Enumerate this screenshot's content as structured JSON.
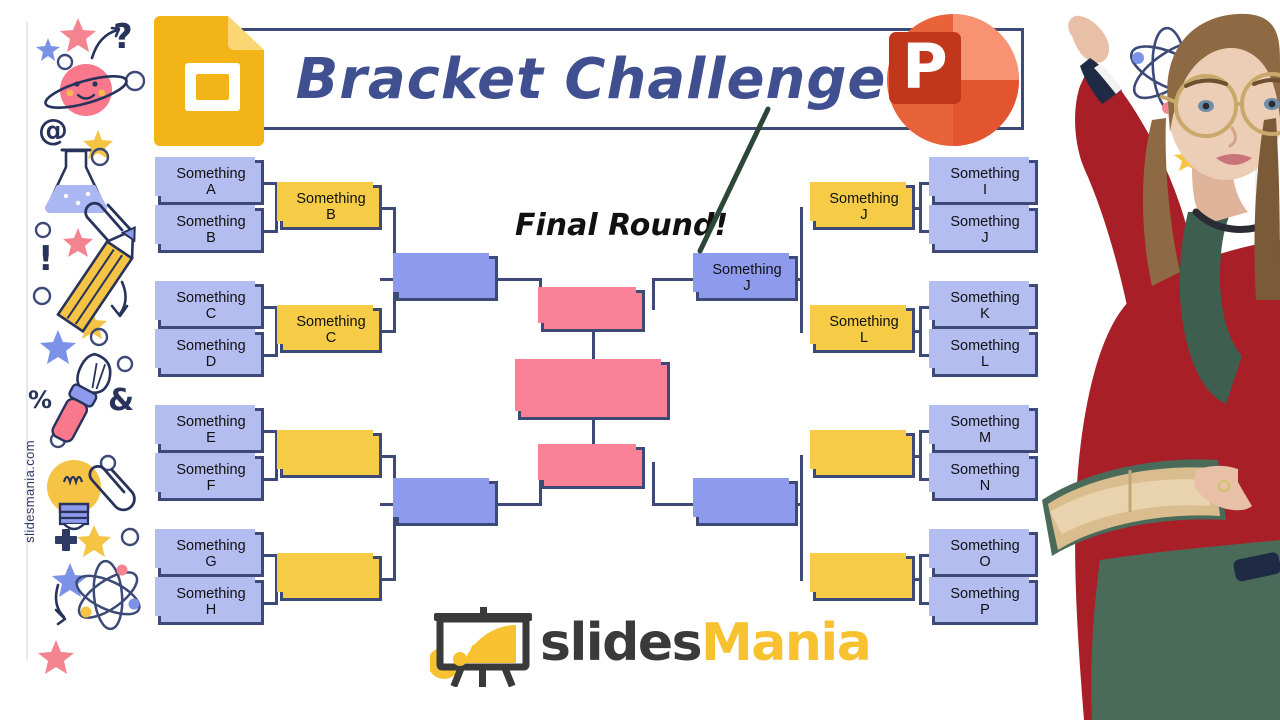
{
  "slide": {
    "title": "Bracket Challenge",
    "final_round_label": "Final Round!",
    "watermark_url": "slidesmania.com",
    "footer_logo": {
      "part1": "slides",
      "part2": "Mania"
    },
    "colors": {
      "outline": "#3d4a78",
      "title_text": "#3f4f8f",
      "round1_blue": "#b3bdf0",
      "semifinal_blue": "#8e9bec",
      "round2_gold": "#f6cb45",
      "final_pink": "#fb8296",
      "logo_yellow": "#f7c12f",
      "logo_dark": "#3a3a3a"
    }
  },
  "logos": {
    "google_slides": "google-slides-logo",
    "powerpoint": "powerpoint-logo",
    "powerpoint_letter": "P"
  },
  "bracket": {
    "left": {
      "round1": [
        {
          "line1": "Something",
          "line2": "A"
        },
        {
          "line1": "Something",
          "line2": "B"
        },
        {
          "line1": "Something",
          "line2": "C"
        },
        {
          "line1": "Something",
          "line2": "D"
        },
        {
          "line1": "Something",
          "line2": "E"
        },
        {
          "line1": "Something",
          "line2": "F"
        },
        {
          "line1": "Something",
          "line2": "G"
        },
        {
          "line1": "Something",
          "line2": "H"
        }
      ],
      "round2": [
        {
          "line1": "Something",
          "line2": "B"
        },
        {
          "line1": "Something",
          "line2": "C"
        },
        {
          "line1": "",
          "line2": ""
        },
        {
          "line1": "",
          "line2": ""
        }
      ],
      "semifinals": [
        {
          "line1": "",
          "line2": ""
        },
        {
          "line1": "",
          "line2": ""
        }
      ]
    },
    "right": {
      "round1": [
        {
          "line1": "Something",
          "line2": "I"
        },
        {
          "line1": "Something",
          "line2": "J"
        },
        {
          "line1": "Something",
          "line2": "K"
        },
        {
          "line1": "Something",
          "line2": "L"
        },
        {
          "line1": "Something",
          "line2": "M"
        },
        {
          "line1": "Something",
          "line2": "N"
        },
        {
          "line1": "Something",
          "line2": "O"
        },
        {
          "line1": "Something",
          "line2": "P"
        }
      ],
      "round2": [
        {
          "line1": "Something",
          "line2": "J"
        },
        {
          "line1": "Something",
          "line2": "L"
        },
        {
          "line1": "",
          "line2": ""
        },
        {
          "line1": "",
          "line2": ""
        }
      ],
      "semifinals": [
        {
          "line1": "Something",
          "line2": "J"
        },
        {
          "line1": "",
          "line2": ""
        }
      ]
    },
    "final": {
      "left_finalist": {
        "line1": "",
        "line2": ""
      },
      "champion": {
        "line1": "",
        "line2": ""
      },
      "right_finalist": {
        "line1": "",
        "line2": ""
      }
    }
  },
  "doodles": {
    "left": [
      "star-icon",
      "star-icon",
      "circle-icon",
      "question-mark-icon",
      "arrow-curve-icon",
      "planet-smiley-icon",
      "at-sign-icon",
      "flask-icon",
      "paperclip-icon",
      "pencil-icon",
      "exclamation-icon",
      "percent-icon",
      "paintbrush-icon",
      "ampersand-icon",
      "lightbulb-icon",
      "plus-icon",
      "atom-icon"
    ],
    "right": [
      "atom-icon",
      "star-icon",
      "arrow-up-icon",
      "paperclip-icon",
      "ampersand-icon",
      "circle-icon",
      "star-icon"
    ]
  }
}
